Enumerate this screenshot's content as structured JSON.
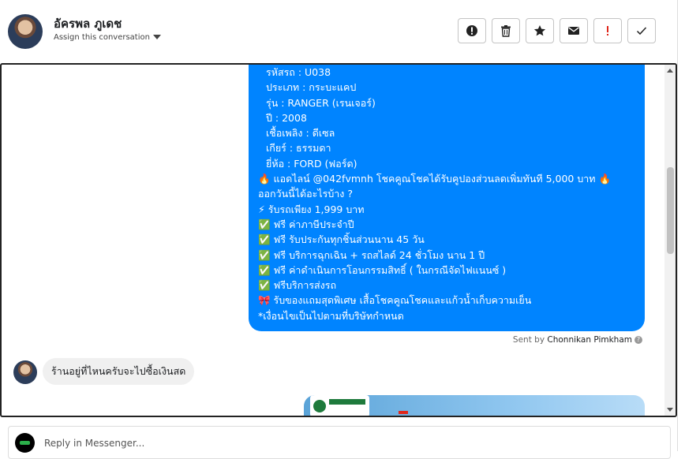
{
  "header": {
    "contact_name": "อัครพล ภูเดช",
    "assign_label": "Assign this conversation",
    "actions": [
      {
        "name": "alert-button",
        "icon": "exclamation-circle-icon"
      },
      {
        "name": "delete-button",
        "icon": "trash-icon"
      },
      {
        "name": "star-button",
        "icon": "star-icon"
      },
      {
        "name": "mail-button",
        "icon": "envelope-icon"
      },
      {
        "name": "spam-button",
        "icon": "exclamation-icon"
      },
      {
        "name": "done-button",
        "icon": "check-icon"
      }
    ]
  },
  "outgoing_message": {
    "lines": [
      "รหัสรถ : U038",
      "ประเภท : กระบะแคป",
      "รุ่น : RANGER (เรนเจอร์)",
      "ปี : 2008",
      "เชื้อเพลิง : ดีเซล",
      "เกียร์ : ธรรมดา",
      "ยี่ห้อ : FORD (ฟอร์ด)",
      "🔥 แอดไลน์ @042fvmnh โชคคูณโชคได้รับคูปองส่วนลดเพิ่มทันที 5,000 บาท 🔥",
      "ออกวันนี้ได้อะไรบ้าง ?",
      "⚡ รับรถเพียง 1,999 บาท",
      "✅ ฟรี ค่าภาษีประจำปี",
      "✅ ฟรี รับประกันทุกชิ้นส่วนนาน 45 วัน",
      "✅ ฟรี บริการฉุกเฉิน + รถสไลด์ 24 ชั่วโมง นาน 1 ปี",
      "✅ ฟรี ค่าดำเนินการโอนกรรมสิทธิ์ ( ในกรณีจัดไฟแนนซ์ )",
      "✅ ฟรีบริการส่งรถ",
      "🎀 รับของแถมสุดพิเศษ เสื้อโชคคูณโชคและแก้วน้ำเก็บความเย็น",
      "*เงื่อนไขเป็นไปตามที่บริษัทกำหนด"
    ],
    "sent_by_prefix": "Sent by",
    "sent_by_name": "Chonnikan Pimkham",
    "help_glyph": "?"
  },
  "incoming_message": {
    "text": "ร้านอยู่ที่ไหนครับจะไปซื้อเงินสด"
  },
  "composer": {
    "placeholder": "Reply in Messenger..."
  },
  "colors": {
    "bubble": "#0084ff",
    "incoming_bubble": "#f0f0f0"
  }
}
